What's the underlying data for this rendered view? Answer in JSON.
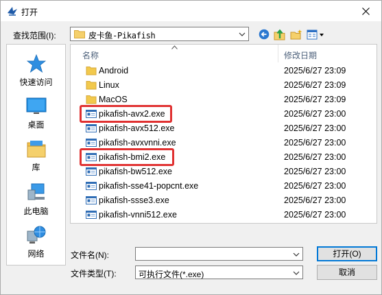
{
  "window": {
    "title": "打开"
  },
  "look_in": {
    "label": "查找范围(I):",
    "value": "皮卡鱼-Pikafish"
  },
  "toolbar": {
    "buttons": [
      {
        "name": "back-icon"
      },
      {
        "name": "up-folder-icon"
      },
      {
        "name": "new-folder-icon"
      },
      {
        "name": "view-menu-icon"
      }
    ]
  },
  "places": [
    {
      "label": "快速访问",
      "icon": "quick-access-icon"
    },
    {
      "label": "桌面",
      "icon": "desktop-icon"
    },
    {
      "label": "库",
      "icon": "library-icon"
    },
    {
      "label": "此电脑",
      "icon": "this-pc-icon"
    },
    {
      "label": "网络",
      "icon": "network-icon"
    }
  ],
  "columns": {
    "name": "名称",
    "date": "修改日期"
  },
  "files": [
    {
      "name": "Android",
      "date": "2025/6/27 23:09",
      "type": "folder"
    },
    {
      "name": "Linux",
      "date": "2025/6/27 23:09",
      "type": "folder"
    },
    {
      "name": "MacOS",
      "date": "2025/6/27 23:09",
      "type": "folder"
    },
    {
      "name": "pikafish-avx2.exe",
      "date": "2025/6/27 23:00",
      "type": "exe",
      "highlighted": true
    },
    {
      "name": "pikafish-avx512.exe",
      "date": "2025/6/27 23:00",
      "type": "exe"
    },
    {
      "name": "pikafish-avxvnni.exe",
      "date": "2025/6/27 23:00",
      "type": "exe"
    },
    {
      "name": "pikafish-bmi2.exe",
      "date": "2025/6/27 23:00",
      "type": "exe",
      "highlighted": true
    },
    {
      "name": "pikafish-bw512.exe",
      "date": "2025/6/27 23:00",
      "type": "exe"
    },
    {
      "name": "pikafish-sse41-popcnt.exe",
      "date": "2025/6/27 23:00",
      "type": "exe"
    },
    {
      "name": "pikafish-ssse3.exe",
      "date": "2025/6/27 23:00",
      "type": "exe"
    },
    {
      "name": "pikafish-vnni512.exe",
      "date": "2025/6/27 23:00",
      "type": "exe"
    }
  ],
  "file_name": {
    "label": "文件名(N):",
    "value": ""
  },
  "file_type": {
    "label": "文件类型(T):",
    "value": "可执行文件(*.exe)"
  },
  "buttons": {
    "open": "打开(O)",
    "cancel": "取消"
  },
  "colors": {
    "highlight": "#e03030",
    "accent": "#0078d7",
    "folder": "#f2c94c"
  }
}
